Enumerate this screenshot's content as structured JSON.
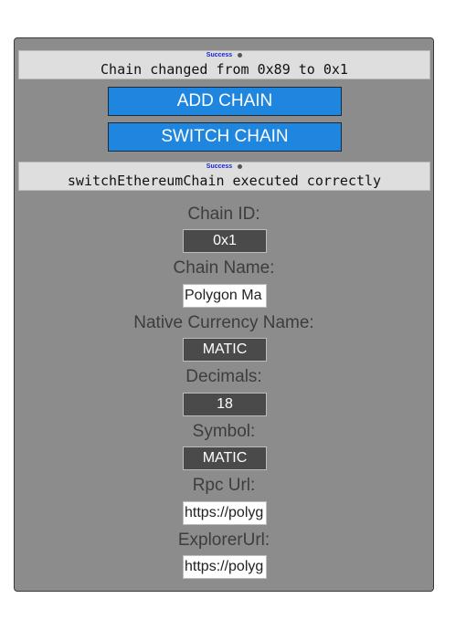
{
  "status_top": {
    "tag": "Success",
    "message": "Chain changed from 0x89 to 0x1"
  },
  "buttons": {
    "add_chain": "ADD CHAIN",
    "switch_chain": "SWITCH CHAIN"
  },
  "status_bottom": {
    "tag": "Success",
    "message": "switchEthereumChain executed correctly"
  },
  "form": {
    "chain_id": {
      "label": "Chain ID:",
      "value": "0x1"
    },
    "chain_name": {
      "label": "Chain Name:",
      "value": "Polygon Ma"
    },
    "currency_name": {
      "label": "Native Currency Name:",
      "value": "MATIC"
    },
    "decimals": {
      "label": "Decimals:",
      "value": "18"
    },
    "symbol": {
      "label": "Symbol:",
      "value": "MATIC"
    },
    "rpc_url": {
      "label": "Rpc Url:",
      "value": "https://polyg"
    },
    "explorer_url": {
      "label": "ExplorerUrl:",
      "value": "https://polyg"
    }
  },
  "colors": {
    "panel": "#8c8c8c",
    "button": "#1f86e0",
    "status_tag": "#1a22d6",
    "dark_input": "#4a4a4a"
  }
}
